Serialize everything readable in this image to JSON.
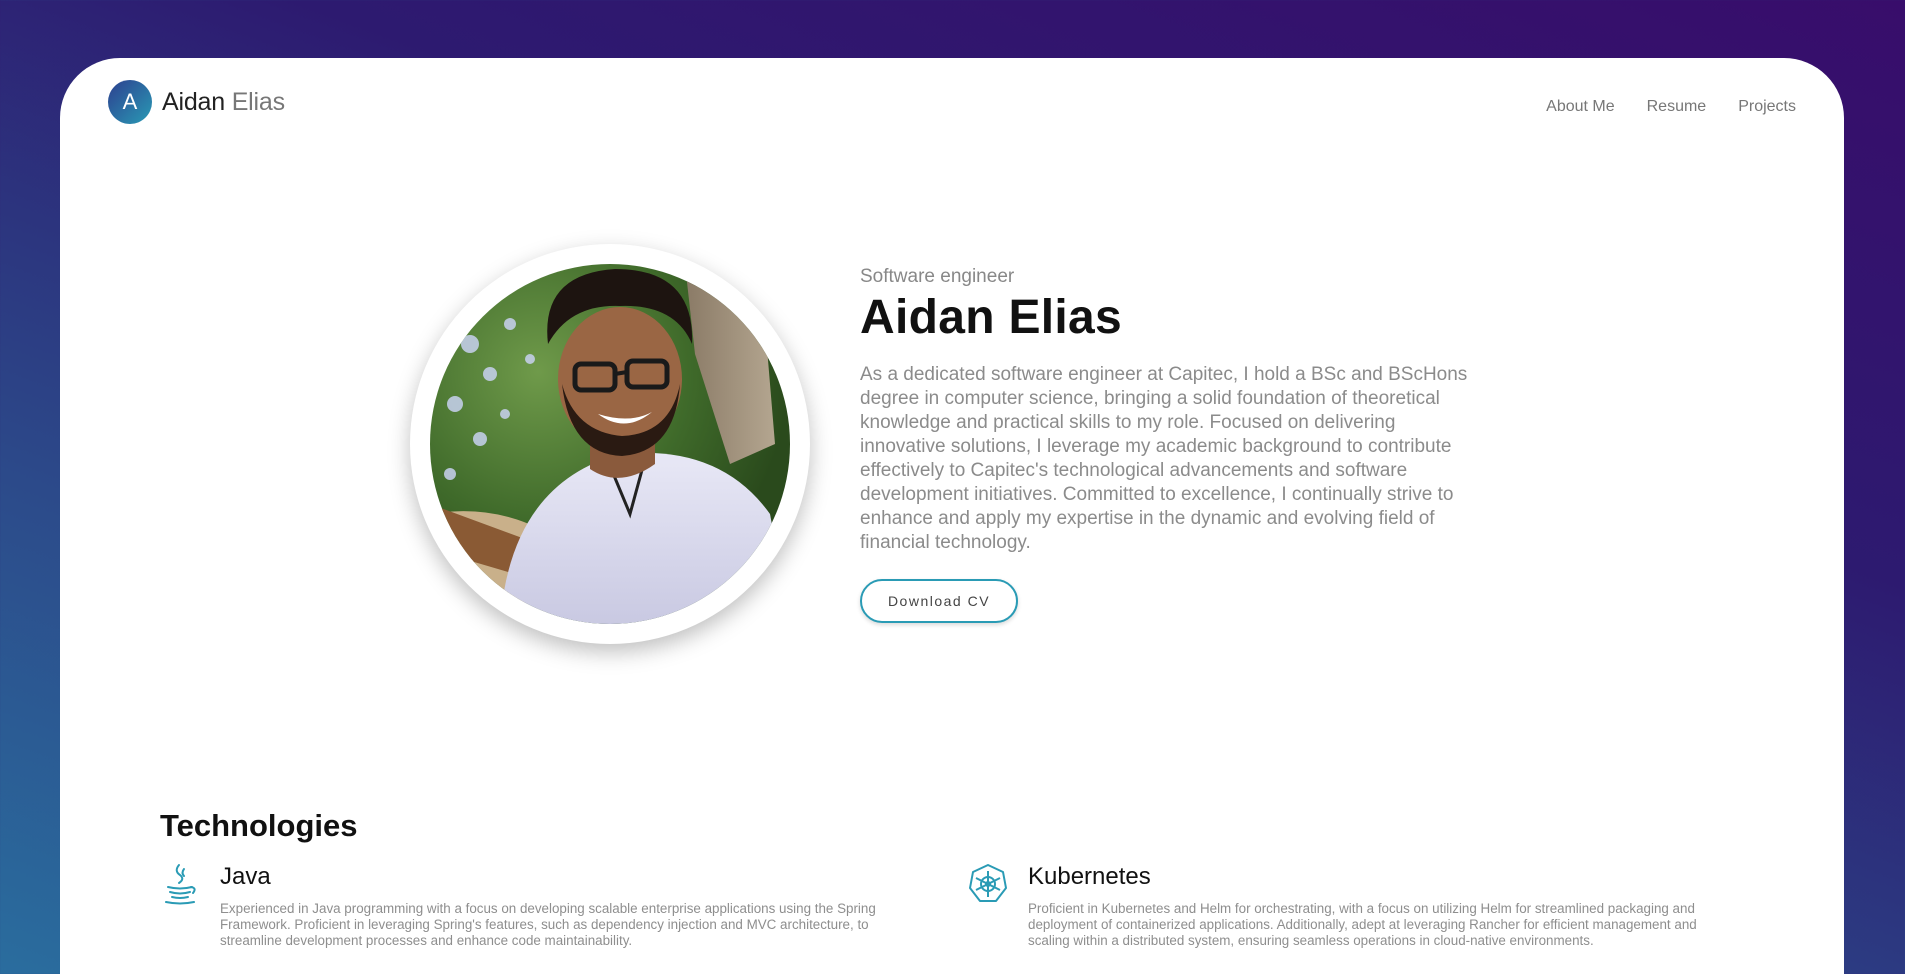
{
  "header": {
    "logo_initial": "A",
    "logo_first": "Aidan",
    "logo_last": "Elias",
    "nav": [
      {
        "label": "About Me"
      },
      {
        "label": "Resume"
      },
      {
        "label": "Projects"
      }
    ]
  },
  "hero": {
    "role": "Software engineer",
    "name": "Aidan Elias",
    "bio": "As a dedicated software engineer at Capitec, I hold a BSc and BScHons degree in computer science, bringing a solid foundation of theoretical knowledge and practical skills to my role. Focused on delivering innovative solutions, I leverage my academic background to contribute effectively to Capitec's technological advancements and software development initiatives. Committed to excellence, I continually strive to enhance and apply my expertise in the dynamic and evolving field of financial technology.",
    "download_label": "Download CV"
  },
  "technologies": {
    "heading": "Technologies",
    "items": [
      {
        "icon": "java-icon",
        "title": "Java",
        "description": "Experienced in Java programming with a focus on developing scalable enterprise applications using the Spring Framework. Proficient in leveraging Spring's features, such as dependency injection and MVC architecture, to streamline development processes and enhance code maintainability."
      },
      {
        "icon": "kubernetes-icon",
        "title": "Kubernetes",
        "description": "Proficient in Kubernetes and Helm for orchestrating, with a focus on utilizing Helm for streamlined packaging and deployment of containerized applications. Additionally, adept at leveraging Rancher for efficient management and scaling within a distributed system, ensuring seamless operations in cloud-native environments."
      }
    ]
  },
  "colors": {
    "accent": "#2a9bb5",
    "background_top": "#380d6b",
    "background_bottom": "#2a6d9e"
  }
}
